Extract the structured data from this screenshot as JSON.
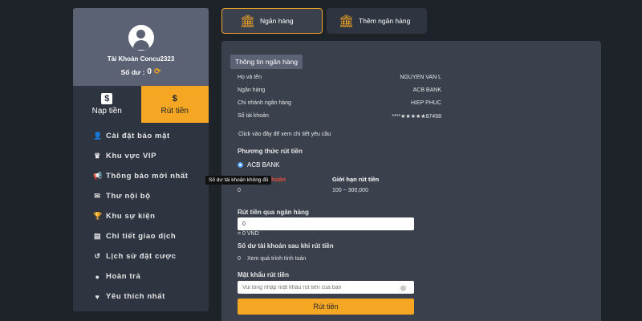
{
  "profile": {
    "username": "Tài Khoản Concu2323",
    "balance_label": "Số dư :",
    "balance_value": "0"
  },
  "actions": {
    "deposit_label": "Nạp tiền",
    "withdraw_label": "Rút tiền"
  },
  "menu": [
    {
      "label": "Cài đặt bảo mật",
      "icon": "user-cog-icon"
    },
    {
      "label": "Khu vực VIP",
      "icon": "crown-icon"
    },
    {
      "label": "Thông báo mới nhất",
      "icon": "megaphone-icon"
    },
    {
      "label": "Thư nội bộ",
      "icon": "mail-icon"
    },
    {
      "label": "Khu sự kiện",
      "icon": "trophy-icon"
    },
    {
      "label": "Chi tiết giao dịch",
      "icon": "document-icon"
    },
    {
      "label": "Lịch sử đặt cược",
      "icon": "history-icon"
    },
    {
      "label": "Hoàn trả",
      "icon": "coin-icon"
    },
    {
      "label": "Yêu thích nhất",
      "icon": "heart-icon"
    }
  ],
  "tabs": {
    "bank_label": "Ngân hàng",
    "add_bank_label": "Thêm ngân hàng"
  },
  "bank_info": {
    "header": "Thông tin ngân hàng",
    "rows": [
      {
        "label": "Họ và tên",
        "value": "NGUYEN VAN L"
      },
      {
        "label": "Ngân hàng",
        "value": "ACB BANK"
      },
      {
        "label": "Chi nhánh ngân hàng",
        "value": "HIEP PHUC"
      },
      {
        "label": "Số tài khoản",
        "value": "****★★★★★87458"
      }
    ],
    "detail_link": "Click vào đây để xem chi tiết yêu cầu"
  },
  "withdraw": {
    "method_title": "Phương thức rút tiền",
    "method_option": "ACB BANK",
    "balance_col_label": "hoản",
    "balance_col_value": "0",
    "limit_col_label": "Giới hạn rút tiền",
    "limit_col_value": "100 ~ 300,000",
    "tooltip": "Số dư tài khoản không đủ",
    "amount_title": "Rút tiền qua ngân hàng",
    "amount_value": "0",
    "amount_converted": "= 0 VND",
    "after_title": "Số dư tài khoản sau khi rút tiền",
    "after_value": "0",
    "after_link": "Xem quá trình tính toán",
    "password_title": "Mật khẩu rút tiền",
    "password_placeholder": "Vui lòng nhập mật khẩu rút tiền của bạn",
    "submit_label": "Rút tiền"
  },
  "colors": {
    "accent": "#f5a623",
    "background": "#1e2229",
    "panel": "#3a404c",
    "sidebar": "#2e3440",
    "profile": "#5a6273",
    "tooltip_text_red": "#e74c3c"
  }
}
